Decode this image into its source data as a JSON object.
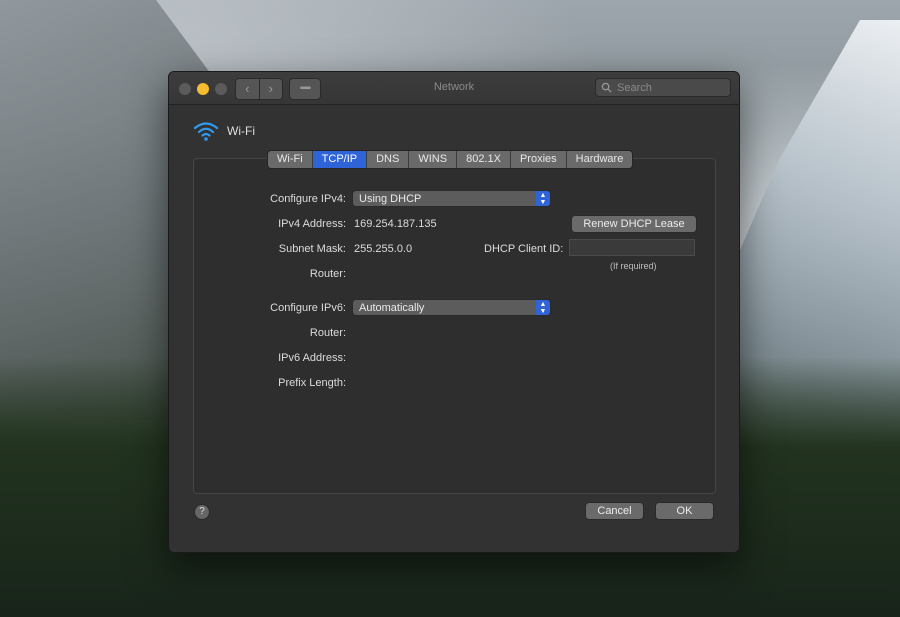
{
  "window": {
    "title": "Network"
  },
  "toolbar": {
    "back_icon": "chevron-left-icon",
    "forward_icon": "chevron-right-icon",
    "grid_icon": "grid-icon",
    "search": {
      "placeholder": "Search",
      "value": ""
    }
  },
  "interface": {
    "name": "Wi-Fi",
    "icon": "wifi-icon",
    "accent": "#2f9bf4"
  },
  "tabs": [
    "Wi-Fi",
    "TCP/IP",
    "DNS",
    "WINS",
    "802.1X",
    "Proxies",
    "Hardware"
  ],
  "active_tab": "TCP/IP",
  "ipv4": {
    "configure_label": "Configure IPv4:",
    "configure_value": "Using DHCP",
    "address_label": "IPv4 Address:",
    "address_value": "169.254.187.135",
    "subnet_label": "Subnet Mask:",
    "subnet_value": "255.255.0.0",
    "router_label": "Router:",
    "renew_button": "Renew DHCP Lease",
    "dhcp_client_label": "DHCP Client ID:",
    "dhcp_client_value": "",
    "dhcp_hint": "(If required)"
  },
  "ipv6": {
    "configure_label": "Configure IPv6:",
    "configure_value": "Automatically",
    "router_label": "Router:",
    "address_label": "IPv6 Address:",
    "prefix_label": "Prefix Length:"
  },
  "footer": {
    "help": "?",
    "cancel": "Cancel",
    "ok": "OK"
  },
  "colors": {
    "accent": "#2f63d8",
    "window_bg": "#323232"
  }
}
